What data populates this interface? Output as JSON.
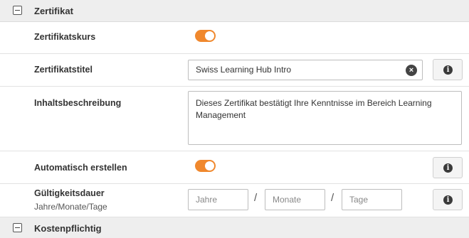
{
  "sections": {
    "zertifikat": {
      "title": "Zertifikat"
    },
    "kostenpflichtig": {
      "title": "Kostenpflichtig"
    }
  },
  "fields": {
    "zertifikatskurs": {
      "label": "Zertifikatskurs",
      "enabled": true
    },
    "zertifikatstitel": {
      "label": "Zertifikatstitel",
      "value": "Swiss Learning Hub Intro"
    },
    "inhaltsbeschreibung": {
      "label": "Inhaltsbeschreibung",
      "value": "Dieses Zertifikat bestätigt Ihre Kenntnisse im Bereich Learning Management"
    },
    "automatisch_erstellen": {
      "label": "Automatisch erstellen",
      "enabled": true
    },
    "gueltigkeitsdauer": {
      "label": "Gültigkeitsdauer",
      "sublabel": "Jahre/Monate/Tage",
      "jahre_placeholder": "Jahre",
      "monate_placeholder": "Monate",
      "tage_placeholder": "Tage",
      "separator": "/"
    }
  },
  "icons": {
    "info": "i",
    "clear": "×"
  },
  "colors": {
    "toggle_on": "#f0882d",
    "section_header_bg": "#eeeeee"
  }
}
